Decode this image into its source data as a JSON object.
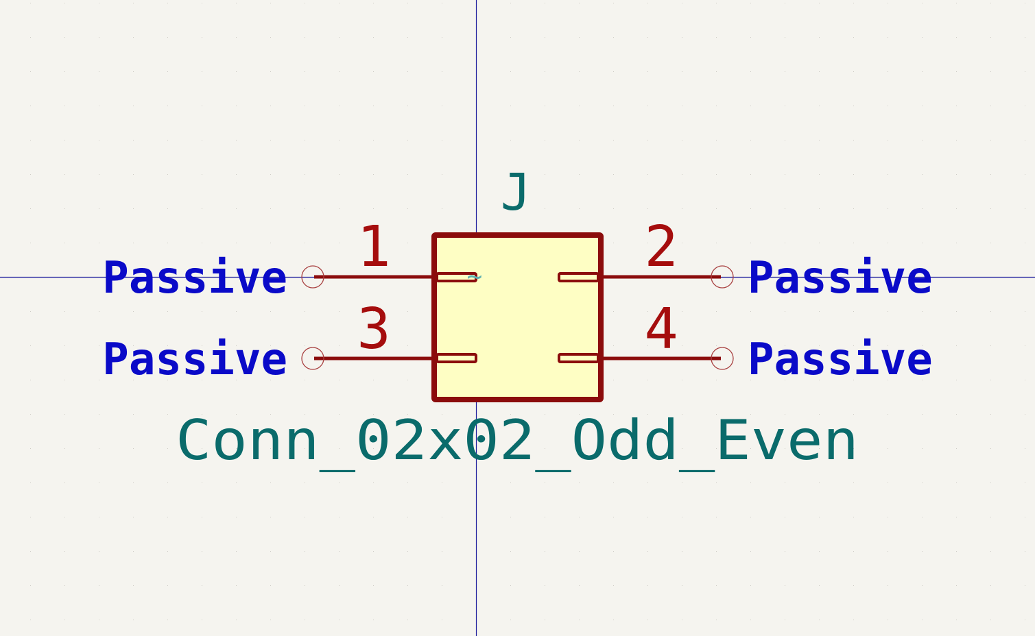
{
  "symbol": {
    "reference": "J",
    "value": "Conn_02x02_Odd_Even",
    "pins": [
      {
        "number": "1",
        "type": "Passive",
        "side": "left"
      },
      {
        "number": "2",
        "type": "Passive",
        "side": "right"
      },
      {
        "number": "3",
        "type": "Passive",
        "side": "left"
      },
      {
        "number": "4",
        "type": "Passive",
        "side": "right"
      }
    ],
    "unit_marker": "~"
  },
  "colors": {
    "background": "#f5f4ef",
    "grid_dot": "#c9c8c2",
    "axis": "#1c1c9c",
    "body_outline": "#8b0c0c",
    "body_fill": "#fefec4",
    "pin_line": "#8b0c0c",
    "pin_number": "#a50d0d",
    "pin_type": "#0a0ac8",
    "field_text": "#0a6b6b",
    "pin_end": "#a84040",
    "unit_marker": "#5fb0b0"
  }
}
